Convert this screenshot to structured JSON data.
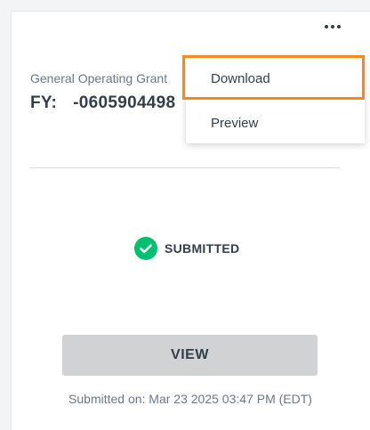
{
  "card": {
    "grant_label": "General Operating Grant",
    "grant_id_prefix": "FY:",
    "grant_id_suffix": "-0605904498",
    "status_text": "SUBMITTED",
    "view_label": "VIEW",
    "submitted_on": "Submitted on: Mar 23 2025 03:47 PM (EDT)"
  },
  "menu": {
    "items": [
      {
        "label": "Download"
      },
      {
        "label": "Preview"
      }
    ]
  },
  "colors": {
    "accent_highlight": "#f5891f",
    "success": "#00bf6f",
    "button_bg": "#d0d2d3",
    "text_primary": "#333e48",
    "text_secondary": "#6b7785"
  },
  "icons": {
    "more": "more-horizontal-icon",
    "status": "check-circle-icon"
  }
}
